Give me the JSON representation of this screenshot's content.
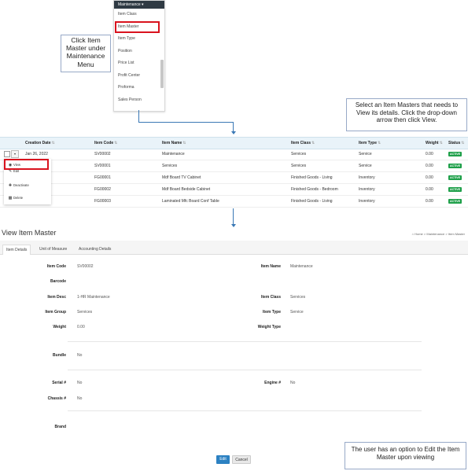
{
  "menu": {
    "title": "Maintenance ▾",
    "items": [
      "Item Class",
      "Item Master",
      "Item Type",
      "Position",
      "Price List",
      "Profit Center",
      "Proforma",
      "Sales Person"
    ],
    "selected": "Item Master"
  },
  "callouts": {
    "menu": "Click Item Master under Maintenance Menu",
    "select": "Select an Item Masters that needs to View its details. Click the drop-down arrow then click View.",
    "edit": "The user has an option to Edit the Item Master upon viewing"
  },
  "grid": {
    "headers": {
      "creation_date": "Creation Date",
      "item_code": "Item Code",
      "item_name": "Item Name",
      "item_class": "Item Class",
      "item_type": "Item Type",
      "weight": "Weight",
      "status": "Status"
    },
    "sort_icon": "⇅",
    "rows": [
      {
        "date": "Jan 26, 2022",
        "code": "SV00002",
        "name": "Maintenance",
        "cls": "Services",
        "type": "Service",
        "weight": "0.00",
        "status": "ACTIVE"
      },
      {
        "date": "",
        "code": "SV00001",
        "name": "Services",
        "cls": "Services",
        "type": "Service",
        "weight": "0.00",
        "status": "ACTIVE"
      },
      {
        "date": "",
        "code": "FG00001",
        "name": "Mdf Board TV Cabinet",
        "cls": "Finished Goods - Living",
        "type": "Inventory",
        "weight": "0.00",
        "status": "ACTIVE"
      },
      {
        "date": "",
        "code": "FG00002",
        "name": "Mdf Board Bedside Cabinet",
        "cls": "Finished Goods - Bedroom",
        "type": "Inventory",
        "weight": "0.00",
        "status": "ACTIVE"
      },
      {
        "date": "",
        "code": "FG00003",
        "name": "Laminated Mfc Board Conf Table",
        "cls": "Finished Goods - Living",
        "type": "Inventory",
        "weight": "0.00",
        "status": "ACTIVE"
      }
    ],
    "actions": {
      "view": "View",
      "edit": "Edit",
      "deactivate": "Deactivate",
      "delete": "Delete"
    }
  },
  "view": {
    "title": "View Item Master",
    "breadcrumb": {
      "home": "Home",
      "sep": ">",
      "maintenance": "Maintenance",
      "current": "Item Master"
    },
    "tabs": [
      "Item Details",
      "Unit of Measure",
      "Accounting Details"
    ],
    "labels": {
      "item_code": "Item Code",
      "item_name": "Item Name",
      "barcode": "Barcode",
      "item_desc": "Item Desc",
      "item_class": "Item Class",
      "item_group": "Item Group",
      "item_type": "Item Type",
      "weight": "Weight",
      "weight_type": "Weight Type",
      "bundle": "Bundle",
      "serial": "Serial #",
      "engine": "Engine #",
      "chassis": "Chassis #",
      "brand": "Brand"
    },
    "values": {
      "item_code": "SV00002",
      "item_name": "Maintenance",
      "item_desc": "1-HR Maintenance",
      "item_class": "Services",
      "item_group": "Services",
      "item_type": "Service",
      "weight": "0.00",
      "bundle": "No",
      "serial": "No",
      "engine": "No",
      "chassis": "No"
    },
    "buttons": {
      "edit": "Edit",
      "cancel": "Cancel"
    }
  },
  "colors": {
    "active": "#1fa04a",
    "highlight": "#d9131e",
    "primary": "#2c81c2",
    "header_bg": "#2f3a43"
  }
}
